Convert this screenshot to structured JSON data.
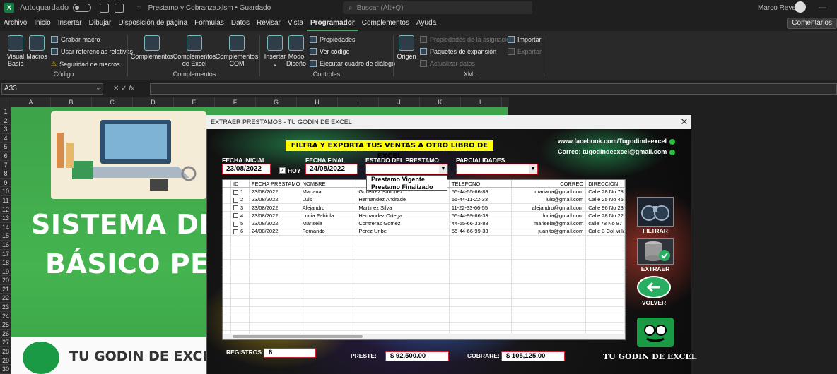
{
  "titlebar": {
    "autosave": "Autoguardado",
    "filename": "Prestamo y Cobranza.xlsm • Guardado",
    "search_placeholder": "Buscar (Alt+Q)",
    "user": "Marco Reyes"
  },
  "menu": [
    "Archivo",
    "Inicio",
    "Insertar",
    "Dibujar",
    "Disposición de página",
    "Fórmulas",
    "Datos",
    "Revisar",
    "Vista",
    "Programador",
    "Complementos",
    "Ayuda"
  ],
  "active_menu": "Programador",
  "comments": "Comentarios",
  "ribbon": {
    "visual_basic": "Visual Basic",
    "macros": "Macros",
    "grabar_macro": "Grabar macro",
    "usar_ref": "Usar referencias relativas",
    "seguridad": "Seguridad de macros",
    "grp_codigo": "Código",
    "complementos": "Complementos",
    "complementos_excel": "Complementos de Excel",
    "complementos_com": "Complementos COM",
    "grp_complementos": "Complementos",
    "insertar": "Insertar",
    "modo_diseno": "Modo Diseño",
    "propiedades": "Propiedades",
    "ver_codigo": "Ver código",
    "ejecutar": "Ejecutar cuadro de diálogo",
    "grp_controles": "Controles",
    "origen": "Origen",
    "prop_asignacion": "Propiedades de la asignación",
    "paquetes": "Paquetes de expansión",
    "actualizar": "Actualizar datos",
    "importar": "Importar",
    "exportar": "Exportar",
    "grp_xml": "XML"
  },
  "namebox": "A33",
  "columns": [
    "A",
    "B",
    "C",
    "D",
    "E",
    "F",
    "G",
    "H",
    "I",
    "J",
    "K",
    "L"
  ],
  "rows": [
    "1",
    "2",
    "3",
    "4",
    "5",
    "6",
    "7",
    "8",
    "9",
    "10",
    "11",
    "12",
    "13",
    "14",
    "15",
    "16",
    "17",
    "18",
    "19",
    "20",
    "21",
    "22",
    "23",
    "24",
    "25",
    "26",
    "27",
    "28",
    "29",
    "30"
  ],
  "sheet": {
    "title1": "SISTEMA DE PI",
    "title2": "BÁSICO PERS",
    "brand": "TU GODIN DE EXCEL"
  },
  "form": {
    "title": "EXTRAER PRESTAMOS - TU GODIN DE EXCEL",
    "banner": "FILTRA Y EXPORTA TUS VENTAS A OTRO LIBRO DE EXCEL",
    "facebook": "www.facebook.com/Tugodindeexcel",
    "correo": "Correo: tugodindeexcel@gmail.com",
    "fecha_inicial_label": "FECHA INICIAL",
    "fecha_inicial": "23/08/2022",
    "hoy": "HOY",
    "fecha_final_label": "FECHA FINAL",
    "fecha_final": "24/08/2022",
    "estado_label": "ESTADO DEL PRESTAMO",
    "estado_value": "",
    "estado_options": [
      "Prestamo Vigente",
      "Prestamo Finalizado"
    ],
    "parcialidades_label": "PARCIALIDADES",
    "parcialidades_value": "",
    "list_headers": [
      "ID",
      "FECHA PRESTAMO",
      "NOMBRE",
      "",
      "TELEFONO",
      "CORREO",
      "DIRECCIÓN"
    ],
    "rows": [
      [
        "1",
        "23/08/2022",
        "Mariana",
        "Gutierrez Sanchez",
        "55-44-55-66-88",
        "mariana@gmail.com",
        "Calle 28 No 78"
      ],
      [
        "2",
        "23/08/2022",
        "Luis",
        "Hernandez Andrade",
        "55-44-11-22-33",
        "luis@gmail.com",
        "Calle 25 No 45"
      ],
      [
        "3",
        "23/08/2022",
        "Alejandro",
        "Martinez Silva",
        "11-22-33-66-55",
        "alejandro@gmail.com",
        "Calle 96 No 23"
      ],
      [
        "4",
        "23/08/2022",
        "Lucia Fabiola",
        "Hernandez Ortega",
        "55-44-99-66-33",
        "lucia@gmail.com",
        "Calle 28 No 22"
      ],
      [
        "5",
        "23/08/2022",
        "Marisela",
        "Contreras Gomez",
        "44-55-66-33-88",
        "marisela@gmail.com",
        "calle 78 No 87"
      ],
      [
        "6",
        "24/08/2022",
        "Fernando",
        "Perez Uribe",
        "55-44-66-99-33",
        "juanito@gmail.com",
        "Calle 3 Col Villa"
      ]
    ],
    "filtrar": "FILTRAR",
    "extraer": "EXTRAER",
    "volver": "VOLVER",
    "registros_label": "REGISTROS",
    "registros": "6",
    "preste_label": "PRESTE:",
    "preste": "$ 92,500.00",
    "cobrare_label": "COBRARE:",
    "cobrare": "$ 105,125.00",
    "brand": "TU GODIN DE EXCEL"
  }
}
